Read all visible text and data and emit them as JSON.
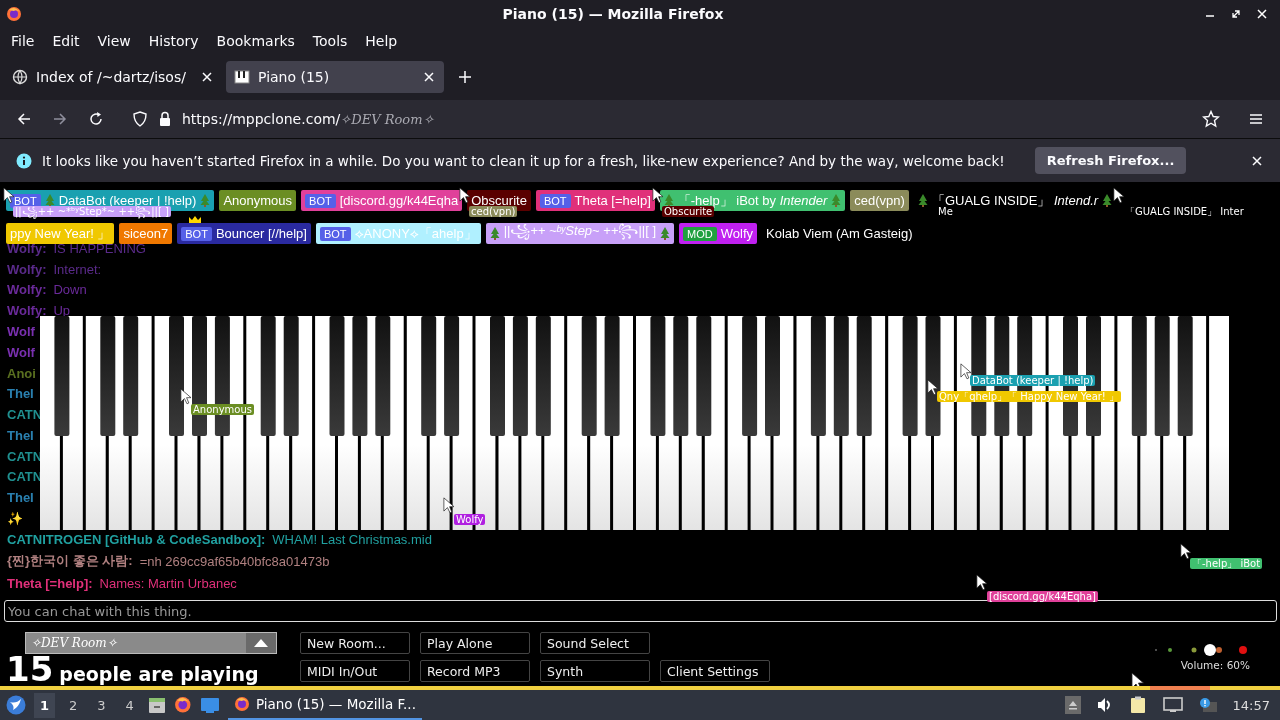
{
  "window": {
    "title": "Piano (15) — Mozilla Firefox"
  },
  "menu": [
    "File",
    "Edit",
    "View",
    "History",
    "Bookmarks",
    "Tools",
    "Help"
  ],
  "tabs": [
    {
      "label": "Index of /~dartz/isos/",
      "selected": false,
      "kind": "folder"
    },
    {
      "label": "Piano (15)",
      "selected": true,
      "kind": "piano"
    }
  ],
  "address": {
    "url": "https://mppclone.com/",
    "path": "✧DEV Room✧"
  },
  "notification": {
    "text": "It looks like you haven’t started Firefox in a while. Do you want to clean it up for a fresh, like-new experience? And by the way, welcome back!",
    "button": "Refresh Firefox..."
  },
  "participants": [
    {
      "name": "DataBot (keeper | !help)",
      "color": "#1aa0b0",
      "badge": "BOT",
      "trees": true
    },
    {
      "name": "Anonymous",
      "color": "#6b8e23"
    },
    {
      "name": "[discord.gg/k44Eqha",
      "color": "#e0409a",
      "badge": "BOT"
    },
    {
      "name": "Obscurite",
      "color": "#5a0000"
    },
    {
      "name": "Theta [=help]",
      "color": "#e0307a",
      "badge": "BOT"
    },
    {
      "name": "「-help」 iBot by *Intender*",
      "color": "#40c070",
      "trees": true
    },
    {
      "name": "ced(vpn)",
      "color": "#8b8b5a"
    },
    {
      "name": "「GUALG INSIDE」 *Intend.r*",
      "color": "#000000",
      "trees": true
    },
    {
      "name": "ppy New Year! 」",
      "color": "#f0c800"
    },
    {
      "name": "siceon7",
      "color": "#f07800"
    },
    {
      "name": "Bouncer [//help]",
      "color": "#2a2aa0",
      "badge": "BOT",
      "crown": true
    },
    {
      "name": "⟡ANONY⟡「ahelp」",
      "color": "#b0f0ff",
      "badge": "BOT"
    },
    {
      "name": "||꧁++ ~*ᵇʸStep*~ ++꧂||[ ]",
      "color": "#c8a0f8",
      "trees": true
    },
    {
      "name": "Wolfy",
      "color": "#c020f0",
      "badge": "MOD"
    },
    {
      "name": "Kolab Viem (Am Gasteig)",
      "color": "#000000"
    }
  ],
  "chat": [
    {
      "name": "Wolfy:",
      "message": "IS HAPPENING",
      "color": "#5a2a8a"
    },
    {
      "name": "Wolfy:",
      "message": "Internet:",
      "color": "#5a2a8a"
    },
    {
      "name": "Wolfy:",
      "message": "Down",
      "color": "#6a2a9a"
    },
    {
      "name": "Wolfy:",
      "message": "Up",
      "color": "#6a2a9a"
    },
    {
      "name": "Wolf",
      "color": "#7a30b0"
    },
    {
      "name": "Wolf",
      "color": "#7a30b0"
    },
    {
      "name": "Anoi",
      "color": "#5a7020"
    },
    {
      "name": "TheI",
      "color": "#2a80b0"
    },
    {
      "name": "CATN",
      "color": "#209090"
    },
    {
      "name": "TheI",
      "color": "#2a80b0"
    },
    {
      "name": "CATN",
      "color": "#209090"
    },
    {
      "name": "CATN",
      "color": "#209090"
    },
    {
      "name": "TheI",
      "color": "#2a80b0"
    },
    {
      "name": "✨",
      "color": "#d0a030"
    },
    {
      "name": "CATNITROGEN [GitHub & CodeSandbox]:",
      "message": "WHAM! Last Christmas.mid",
      "color": "#20a0a0"
    },
    {
      "name": "{찐}한국이 좋은 사람:",
      "message": "=nh 269cc9af65b40bfc8a01473b",
      "color": "#b08080"
    },
    {
      "name": "Theta [=help]:",
      "message": "Names: Martin Urbanec",
      "color": "#e0307a"
    }
  ],
  "cursors": [
    {
      "label": "||꧁++ ~*ᵇʸStep*~ ++꧂||[ ]",
      "color": "#c8a0f8"
    },
    {
      "label": "ced(vpn)",
      "color": "#8b8b5a"
    },
    {
      "label": "Obscurite",
      "color": "#5a0000"
    },
    {
      "label": "Me",
      "color": "#000000"
    },
    {
      "label": "「GUALG INSIDE」 Inter",
      "color": "#000000"
    },
    {
      "label": "Anonymous",
      "color": "#6b8e23"
    },
    {
      "label": "DataBot (keeper | !help)",
      "color": "#1aa0b0"
    },
    {
      "label": "Qny「qhelp」「 Happy New Year! 」",
      "color": "#f0c800"
    },
    {
      "label": "Wolfy",
      "color": "#b020e0"
    },
    {
      "label": "「-help」 iBot",
      "color": "#40c070"
    },
    {
      "label": "[discord.gg/k44Eqha]",
      "color": "#e0409a"
    }
  ],
  "chat_input": {
    "placeholder": "You can chat with this thing."
  },
  "room": {
    "name": "✧DEV Room✧"
  },
  "player_count": {
    "count": "15",
    "text": "people are playing"
  },
  "buttons": [
    [
      "New Room...",
      "Play Alone",
      "Sound Select"
    ],
    [
      "MIDI In/Out",
      "Record MP3",
      "Synth",
      "Client Settings"
    ]
  ],
  "volume": {
    "level": 0.6,
    "reading": "Volume: 60%"
  },
  "taskbar": {
    "workspaces": [
      {
        "label": "1",
        "selected": true
      },
      {
        "label": "2",
        "selected": false
      },
      {
        "label": "3",
        "selected": false
      },
      {
        "label": "4",
        "selected": false
      }
    ],
    "task": "Piano (15) — Mozilla F...",
    "clock": "14:57"
  }
}
